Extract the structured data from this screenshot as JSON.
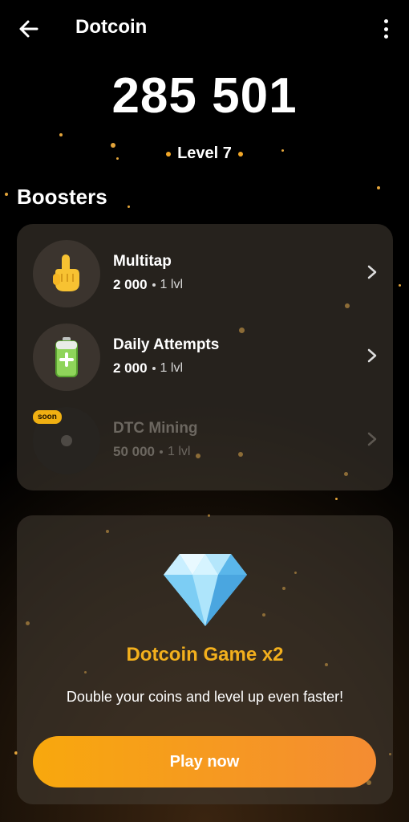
{
  "header": {
    "title": "Dotcoin",
    "back_icon": "arrow-left-icon",
    "menu_icon": "more-vertical-icon"
  },
  "balance": "285 501",
  "level": "Level 7",
  "boosters": {
    "title": "Boosters",
    "items": [
      {
        "name": "Multitap",
        "cost": "2 000",
        "level": "1 lvl",
        "icon": "pointing-finger-icon",
        "enabled": true
      },
      {
        "name": "Daily Attempts",
        "cost": "2 000",
        "level": "1 lvl",
        "icon": "battery-icon",
        "enabled": true
      },
      {
        "name": "DTC Mining",
        "cost": "50 000",
        "level": "1 lvl",
        "icon": "mining-disc-icon",
        "enabled": false,
        "badge": "soon"
      }
    ]
  },
  "promo": {
    "icon": "diamond-icon",
    "title": "Dotcoin Game x2",
    "description": "Double your coins and level up even faster!",
    "button_label": "Play now"
  },
  "colors": {
    "accent": "#f3b01d",
    "button_start": "#f8a80d",
    "button_end": "#f48c32",
    "badge": "#f0b012"
  }
}
